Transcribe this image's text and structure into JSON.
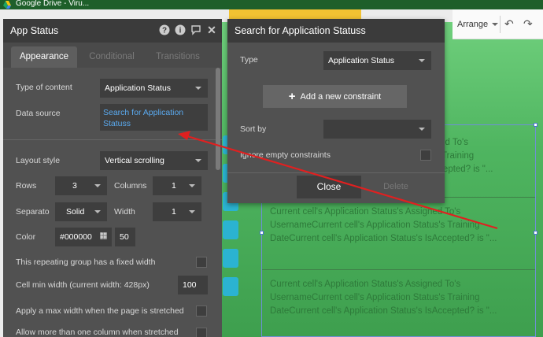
{
  "window": {
    "title": "Google Drive - Viru..."
  },
  "toolbar": {
    "arrange_label": "Arrange"
  },
  "app_status_panel": {
    "title": "App Status",
    "tabs": [
      {
        "label": "Appearance",
        "active": true
      },
      {
        "label": "Conditional",
        "active": false
      },
      {
        "label": "Transitions",
        "active": false
      }
    ],
    "type_of_content_label": "Type of content",
    "type_of_content_value": "Application Status",
    "data_source_label": "Data source",
    "data_source_value": "Search for Application Statuss",
    "layout_style_label": "Layout style",
    "layout_style_value": "Vertical scrolling",
    "rows_label": "Rows",
    "rows_value": "3",
    "columns_label": "Columns",
    "columns_value": "1",
    "separator_label": "Separato",
    "separator_value": "Solid",
    "width_label": "Width",
    "width_value": "1",
    "color_label": "Color",
    "color_value": "#000000",
    "opacity_value": "50",
    "fixed_width_label": "This repeating group has a fixed width",
    "cell_min_width_label": "Cell min width (current width: 428px)",
    "cell_min_width_value": "100",
    "max_width_label": "Apply a max width when the page is stretched",
    "multi_column_label": "Allow more than one column when stretched"
  },
  "search_panel": {
    "title": "Search for Application Statuss",
    "type_label": "Type",
    "type_value": "Application Status",
    "add_constraint_label": "Add a new constraint",
    "sort_by_label": "Sort by",
    "sort_by_value": "",
    "ignore_empty_label": "Ignore empty constraints",
    "close_label": "Close",
    "delete_label": "Delete"
  },
  "repeating_group": {
    "row_text_lines": [
      "Current cell's Application Status's Assigned To's",
      "UsernameCurrent cell's Application Status's Training",
      "DateCurrent cell's Application Status's IsAccepted? is \"..."
    ],
    "visible_partial_row": [
      "signed To's",
      "us's Training",
      "sAccepted? is \"..."
    ]
  },
  "colors": {
    "panel_bg": "#515151",
    "panel_header": "#3b3b3b",
    "link_blue": "#5aa9ee",
    "canvas_green": "#4fb560",
    "annotation_red": "#e02020"
  }
}
